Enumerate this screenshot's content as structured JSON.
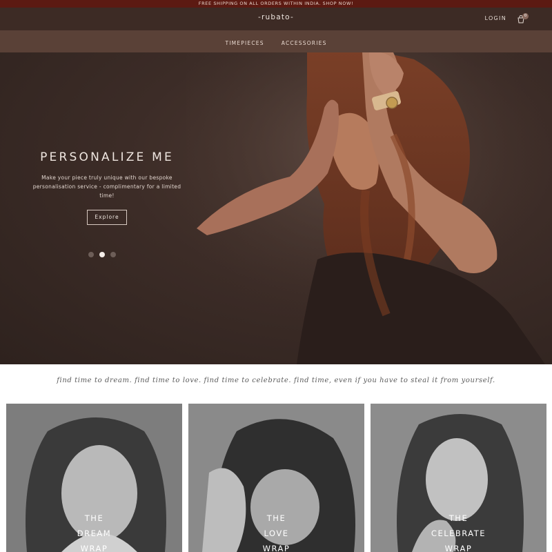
{
  "announcement": "FREE SHIPPING ON ALL ORDERS WITHIN INDIA. SHOP NOW!",
  "header": {
    "logo": "-rubato-",
    "login_label": "LOGIN",
    "cart_count": "0"
  },
  "nav": {
    "items": [
      {
        "label": "TIMEPIECES"
      },
      {
        "label": "ACCESSORIES"
      }
    ]
  },
  "hero": {
    "title": "PERSONALIZE ME",
    "text": "Make your piece truly unique with our bespoke personalisation service - complimentary for a limited time!",
    "button_label": "Explore",
    "slide_count": 3,
    "active_slide": 2
  },
  "tagline": "find time to dream. find time to love. find time to celebrate. find time, even if you have to steal it from yourself.",
  "cards": [
    {
      "line1": "THE",
      "line2": "DREAM",
      "line3": "WRAP"
    },
    {
      "line1": "THE",
      "line2": "LOVE",
      "line3": "WRAP"
    },
    {
      "line1": "THE",
      "line2": "CELEBRATE",
      "line3": "WRAP"
    }
  ],
  "colors": {
    "announcement_bg": "#5c1a12",
    "header_bg": "#3d2b25",
    "nav_bg": "#5a4137",
    "hero_bg": "#3c2c27"
  },
  "icons": {
    "cart": "shopping-bag-icon"
  }
}
